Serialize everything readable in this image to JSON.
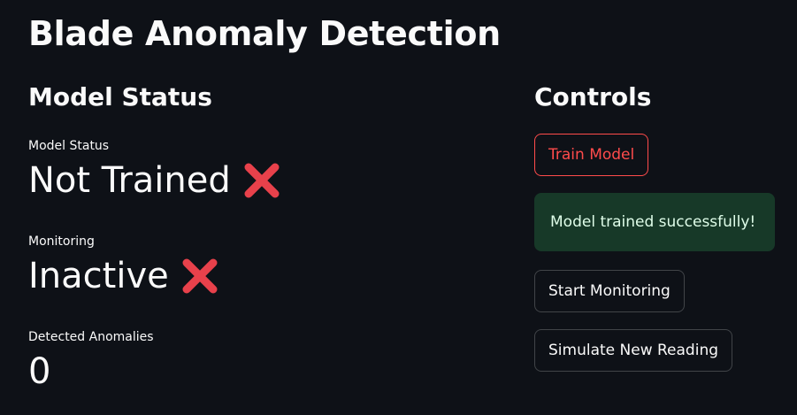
{
  "app": {
    "title": "Blade Anomaly Detection"
  },
  "status_panel": {
    "heading": "Model Status",
    "metrics": [
      {
        "label": "Model Status",
        "value": "Not Trained",
        "icon": "cross-mark-icon"
      },
      {
        "label": "Monitoring",
        "value": "Inactive",
        "icon": "cross-mark-icon"
      },
      {
        "label": "Detected Anomalies",
        "value": "0"
      }
    ]
  },
  "controls_panel": {
    "heading": "Controls",
    "train_button": "Train Model",
    "success_message": "Model trained successfully!",
    "start_button": "Start Monitoring",
    "simulate_button": "Simulate New Reading"
  },
  "colors": {
    "background": "#0e1117",
    "text": "#fafafa",
    "accent_red": "#ff4b4b",
    "success_bg": "#173928",
    "success_text": "#dffde9",
    "cross_mark": "#e8414b"
  }
}
